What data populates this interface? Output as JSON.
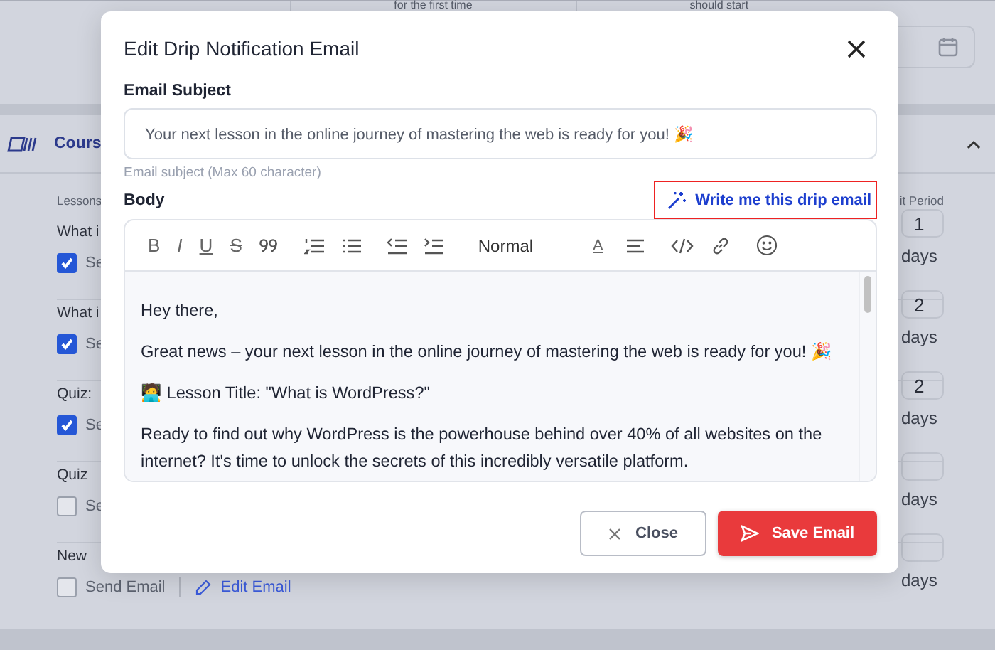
{
  "background": {
    "top_texts": [
      "for the first time",
      "should start"
    ],
    "course": {
      "title": "Cours",
      "lessons_label": "Lessons",
      "period_label": "it Period",
      "rows": [
        {
          "title": "What i",
          "checked": true,
          "send_label": "Se",
          "period": "1",
          "days": "days"
        },
        {
          "title": "What i",
          "checked": true,
          "send_label": "Se",
          "period": "2",
          "days": "days"
        },
        {
          "title": "Quiz:",
          "checked": true,
          "send_label": "Se",
          "period": "2",
          "days": "days"
        },
        {
          "title": "Quiz",
          "checked": false,
          "send_label": "Se",
          "days": "days"
        },
        {
          "title": "New",
          "checked": false,
          "send_label": "Send Email",
          "edit_label": "Edit Email",
          "days": "days"
        }
      ]
    }
  },
  "modal": {
    "title": "Edit Drip Notification Email",
    "subject_label": "Email Subject",
    "subject_value": "Your next lesson in the online journey of mastering the web is ready for you! 🎉",
    "subject_hint": "Email subject (Max 60 character)",
    "body_label": "Body",
    "ai_button": "Write me this drip email",
    "toolbar": [
      {
        "kind": "bold",
        "label": "B"
      },
      {
        "kind": "italic",
        "label": "I"
      },
      {
        "kind": "underline",
        "label": "U"
      },
      {
        "kind": "strike",
        "label": "S"
      },
      {
        "kind": "quote"
      },
      {
        "kind": "ordered-list"
      },
      {
        "kind": "bullet-list"
      },
      {
        "kind": "outdent"
      },
      {
        "kind": "indent"
      },
      {
        "kind": "format",
        "label": "Normal"
      },
      {
        "kind": "color",
        "label": "A"
      },
      {
        "kind": "align"
      },
      {
        "kind": "code"
      },
      {
        "kind": "link"
      },
      {
        "kind": "emoji"
      }
    ],
    "body_paragraphs": [
      "Hey there,",
      "Great news – your next lesson in the online journey of mastering the web is ready for you! 🎉",
      "🧑‍💻 Lesson Title: \"What is WordPress?\"",
      "Ready to find out why WordPress is the powerhouse behind over 40% of all websites on the internet? It's time to unlock the secrets of this incredibly versatile platform."
    ],
    "close_button": "Close",
    "save_button": "Save Email"
  }
}
